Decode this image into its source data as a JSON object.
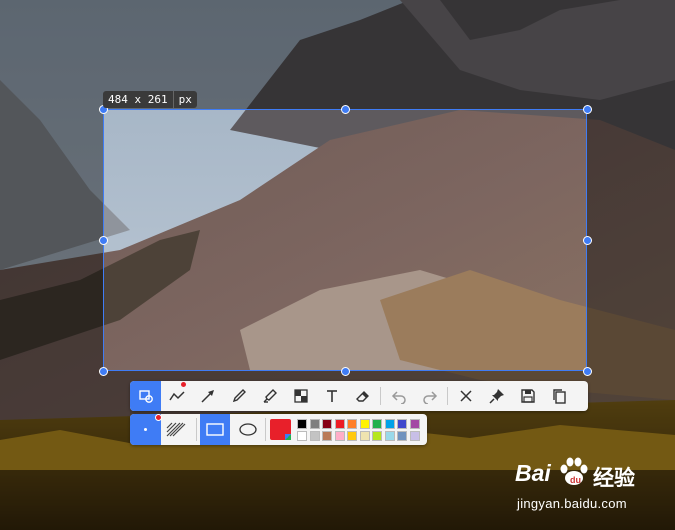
{
  "selection": {
    "size": "484 x 261",
    "unit": "px"
  },
  "watermark": {
    "brand_prefix": "Bai",
    "brand_suffix": "经验",
    "url": "jingyan.baidu.com"
  },
  "toolbar": {
    "tools": [
      "selection-shapes-icon",
      "polyline-icon",
      "arrow-icon",
      "pencil-icon",
      "highlighter-icon",
      "mosaic-icon",
      "text-icon",
      "eraser-icon",
      "undo-icon",
      "redo-icon",
      "cancel-icon",
      "pin-icon",
      "save-icon",
      "copy-icon"
    ]
  },
  "subbar": {
    "selected_color": "#e8202a",
    "palette_top": [
      "#000000",
      "#7f7f7f",
      "#880015",
      "#ed1c24",
      "#ff7f27",
      "#fff200",
      "#22b14c",
      "#00a2e8",
      "#3f48cc",
      "#a349a4"
    ],
    "palette_bottom": [
      "#ffffff",
      "#c3c3c3",
      "#b97a57",
      "#ffaec9",
      "#ffc90e",
      "#efe4b0",
      "#b5e61d",
      "#99d9ea",
      "#7092be",
      "#c8bfe7"
    ]
  },
  "colors": {
    "accent": "#3f7cf5",
    "toolbar_bg": "#f4f4f4"
  }
}
